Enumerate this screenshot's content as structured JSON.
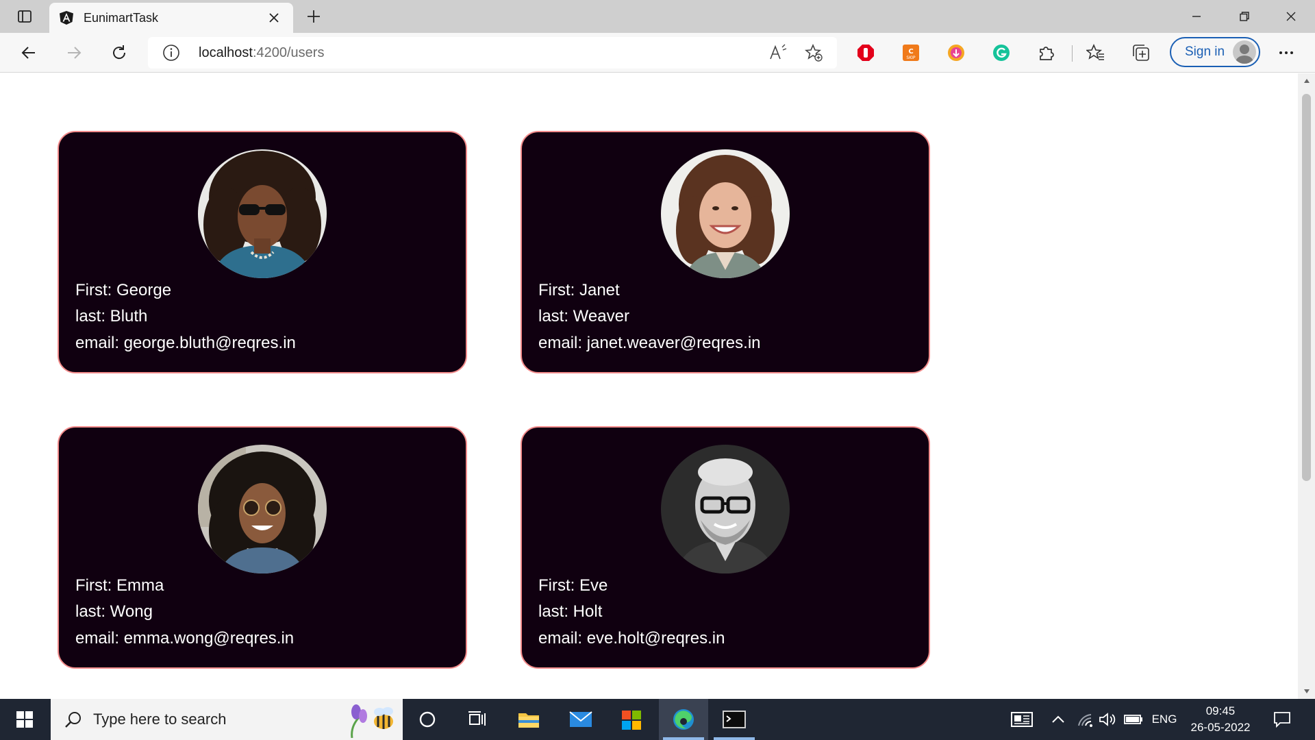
{
  "browser": {
    "tab_title": "EunimartTask",
    "url_host": "localhost",
    "url_path": ":4200/users",
    "sign_in_label": "Sign in",
    "accent": "#1a5fb4"
  },
  "users": [
    {
      "first": "First: George",
      "last": "last: Bluth",
      "email": "email: george.bluth@reqres.in"
    },
    {
      "first": "First: Janet",
      "last": "last: Weaver",
      "email": "email: janet.weaver@reqres.in"
    },
    {
      "first": "First: Emma",
      "last": "last: Wong",
      "email": "email: emma.wong@reqres.in"
    },
    {
      "first": "First: Eve",
      "last": "last: Holt",
      "email": "email: eve.holt@reqres.in"
    }
  ],
  "card_colors": {
    "background": "#100010",
    "border": "#f28b8b"
  },
  "taskbar": {
    "search_placeholder": "Type here to search",
    "language": "ENG",
    "time": "09:45",
    "date": "26-05-2022"
  }
}
